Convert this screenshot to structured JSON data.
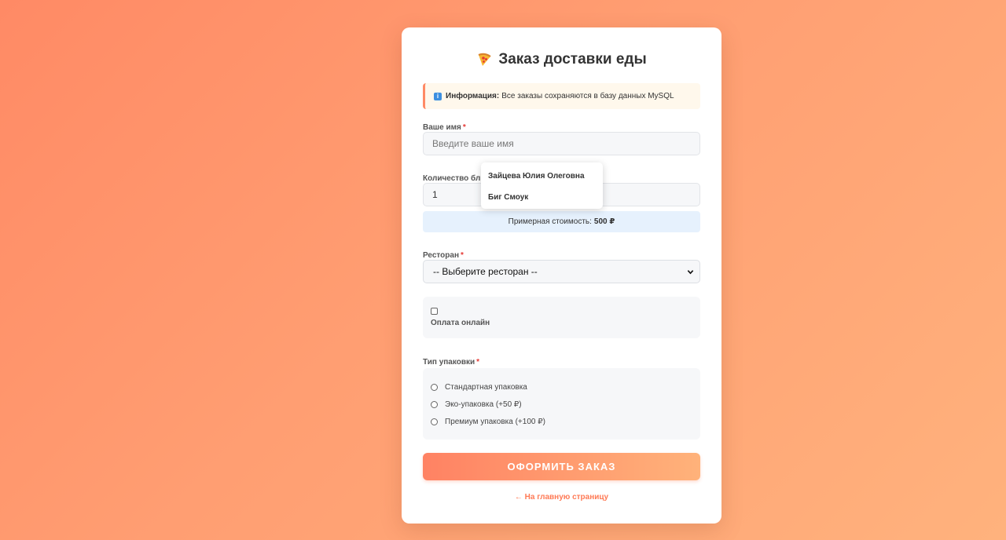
{
  "page": {
    "title_emoji_icon": "pizza-icon",
    "title": "Заказ доставки еды"
  },
  "info": {
    "icon": "info-icon",
    "label": "Информация:",
    "text": "Все заказы сохраняются в базу данных MySQL"
  },
  "name_field": {
    "label": "Ваше имя",
    "required_mark": "*",
    "placeholder": "Введите ваше имя",
    "autocomplete": [
      "Зайцева Юлия Олеговна",
      "Биг Смоук"
    ]
  },
  "quantity_field": {
    "label": "Количество блюд",
    "value": "1"
  },
  "cost": {
    "label": "Примерная стоимость:",
    "value": "500 ₽"
  },
  "restaurant_field": {
    "label": "Ресторан",
    "required_mark": "*",
    "selected": "-- Выберите ресторан --"
  },
  "online_payment": {
    "label": "Оплата онлайн",
    "checked": false
  },
  "packaging": {
    "label": "Тип упаковки",
    "required_mark": "*",
    "options": [
      "Стандартная упаковка",
      "Эко-упаковка (+50 ₽)",
      "Премиум упаковка (+100 ₽)"
    ]
  },
  "submit_label": "ОФОРМИТЬ ЗАКАЗ",
  "back_link": "← На главную страницу",
  "colors": {
    "accent": "#ff8a65",
    "info_bg": "#fff8ec",
    "cost_bg": "#e6f1fd"
  }
}
